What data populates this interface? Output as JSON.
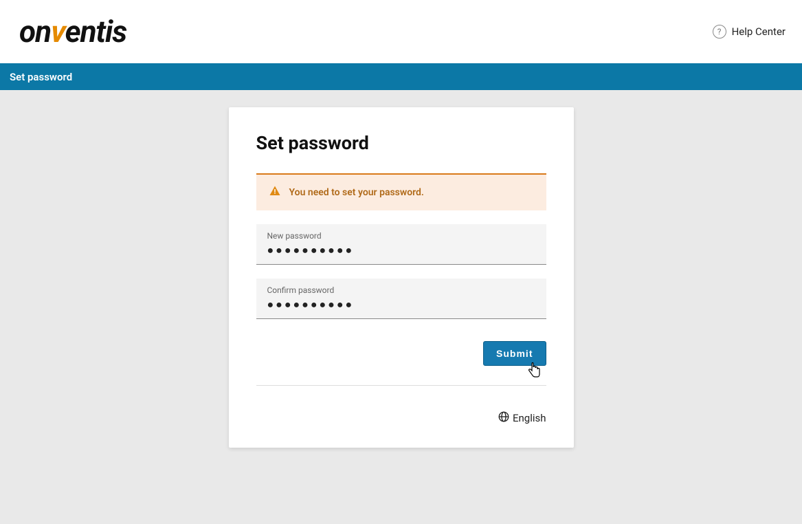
{
  "header": {
    "brand_pre": "on",
    "brand_v": "v",
    "brand_post": "entis",
    "help_label": "Help Center"
  },
  "titlebar": {
    "title": "Set password"
  },
  "card": {
    "heading": "Set password",
    "alert_message": "You need to set your password.",
    "new_password": {
      "label": "New password",
      "value_mask": "●●●●●●●●●●"
    },
    "confirm_password": {
      "label": "Confirm password",
      "value_mask": "●●●●●●●●●●"
    },
    "submit_label": "Submit",
    "language_label": "English"
  }
}
